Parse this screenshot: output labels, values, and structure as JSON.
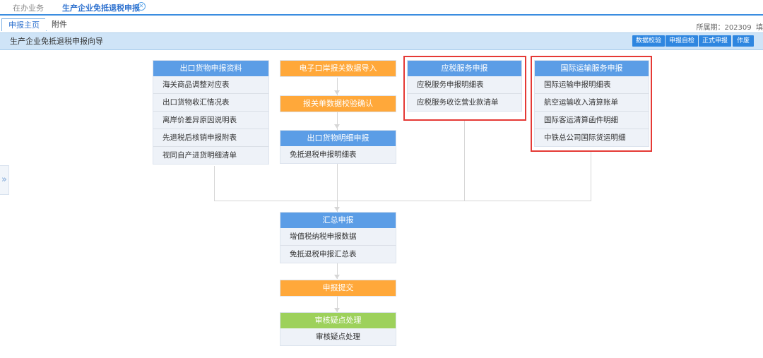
{
  "top_tabs": {
    "tab1": "在办业务",
    "tab2": "生产企业免抵退税申报"
  },
  "sub_tabs": {
    "main": "申报主页",
    "attach": "附件"
  },
  "period": "所属期：202309",
  "period_suffix": "填",
  "wizard": {
    "title": "生产企业免抵退税申报向导",
    "buttons": [
      "数据校验",
      "申报自检",
      "正式申报",
      "作废"
    ]
  },
  "flow": {
    "export_docs": {
      "title": "出口货物申报资料",
      "items": [
        "海关商品调整对应表",
        "出口货物收汇情况表",
        "离岸价差异原因说明表",
        "先退税后核销申报附表",
        "视同自产进货明细清单"
      ]
    },
    "customs_import": "电子口岸报关数据导入",
    "customs_check": "报关单数据校验确认",
    "export_detail": {
      "title": "出口货物明细申报",
      "items": [
        "免抵退税申报明细表"
      ]
    },
    "taxable_service": {
      "title": "应税服务申报",
      "items": [
        "应税服务申报明细表",
        "应税服务收讫营业款清单"
      ]
    },
    "intl_transport": {
      "title": "国际运输服务申报",
      "items": [
        "国际运输申报明细表",
        "航空运输收入清算账单",
        "国际客运清算函件明细",
        "中铁总公司国际货运明细"
      ]
    },
    "summary": {
      "title": "汇总申报",
      "items": [
        "增值税纳税申报数据",
        "免抵退税申报汇总表"
      ]
    },
    "submit": "申报提交",
    "review": {
      "title": "审核疑点处理",
      "items": [
        "审核疑点处理"
      ]
    }
  },
  "colors": {
    "blue_header": "#5b9de6",
    "orange_header": "#ffa83a",
    "green_header": "#9dd15b",
    "highlight": "#e53935",
    "button": "#2e86e0"
  }
}
